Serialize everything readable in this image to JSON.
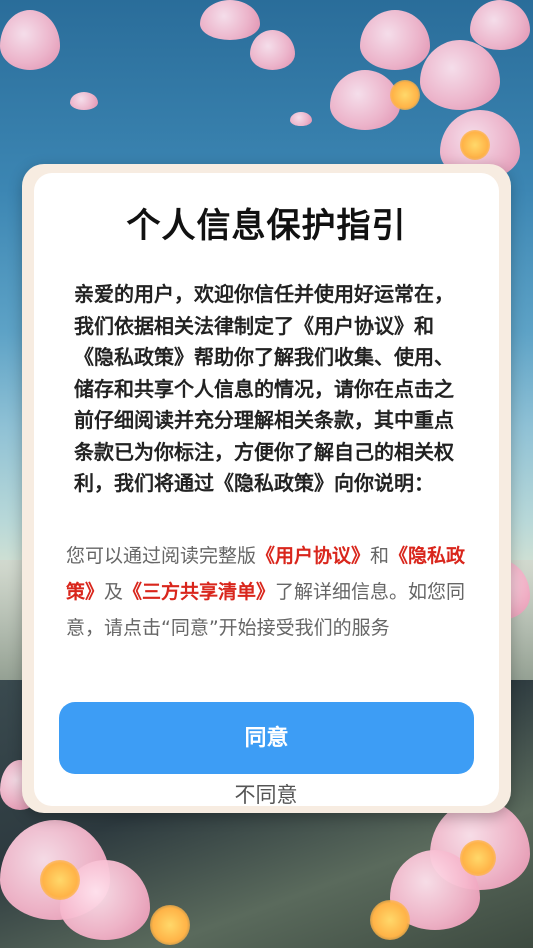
{
  "dialog": {
    "title": "个人信息保护指引",
    "intro": "亲爱的用户，欢迎你信任并使用好运常在，我们依据相关法律制定了《用户协议》和《隐私政策》帮助你了解我们收集、使用、储存和共享个人信息的情况，请你在点击之前仔细阅读并充分理解相关条款，其中重点条款已为你标注，方便你了解自己的相关权利，我们将通过《隐私政策》向你说明：",
    "secondary": {
      "part1": "您可以通过阅读完整版",
      "link_user_agreement": "《用户协议》",
      "part2": "和",
      "link_privacy_policy": "《隐私政策》",
      "part3": "及",
      "link_third_party_list": "《三方共享清单》",
      "part4": "了解详细信息。如您同意，请点击“同意”开始接受我们的服务"
    },
    "agree_label": "同意",
    "disagree_label": "不同意"
  },
  "colors": {
    "accent_button": "#3d9df5",
    "link_red": "#d9261c",
    "dialog_border": "#f7ece1"
  }
}
